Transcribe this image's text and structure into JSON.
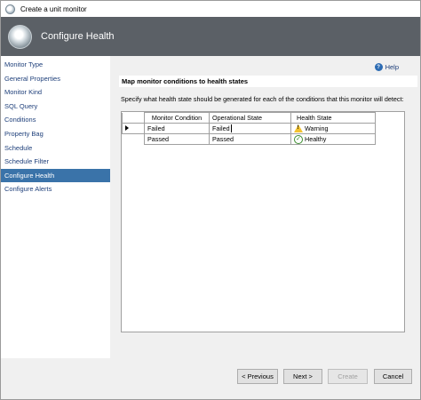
{
  "window": {
    "title": "Create a unit monitor"
  },
  "header": {
    "title": "Configure Health"
  },
  "sidebar": {
    "items": [
      {
        "label": "Monitor Type",
        "active": false
      },
      {
        "label": "General Properties",
        "active": false
      },
      {
        "label": "Monitor Kind",
        "active": false
      },
      {
        "label": "SQL Query",
        "active": false
      },
      {
        "label": "Conditions",
        "active": false
      },
      {
        "label": "Property Bag",
        "active": false
      },
      {
        "label": "Schedule",
        "active": false
      },
      {
        "label": "Schedule Filter",
        "active": false
      },
      {
        "label": "Configure Health",
        "active": true
      },
      {
        "label": "Configure Alerts",
        "active": false
      }
    ]
  },
  "main": {
    "help_label": "Help",
    "section_title": "Map monitor conditions to health states",
    "instruction": "Specify what health state should be generated for each of the conditions that this monitor will detect:",
    "grid": {
      "columns": [
        "Monitor Condition",
        "Operational State",
        "Health State"
      ],
      "rows": [
        {
          "condition": "Failed",
          "operational_state": "Failed",
          "health_state": "Warning",
          "health_icon": "warning-icon"
        },
        {
          "condition": "Passed",
          "operational_state": "Passed",
          "health_state": "Healthy",
          "health_icon": "healthy-check-icon"
        }
      ]
    }
  },
  "footer": {
    "previous_label": "< Previous",
    "next_label": "Next >",
    "create_label": "Create",
    "cancel_label": "Cancel"
  },
  "colors": {
    "header_bg": "#5b6066",
    "active_nav_bg": "#3a73a9",
    "link_text": "#1e3f7a",
    "warning": "#f2c230",
    "healthy": "#3c8d2f"
  }
}
